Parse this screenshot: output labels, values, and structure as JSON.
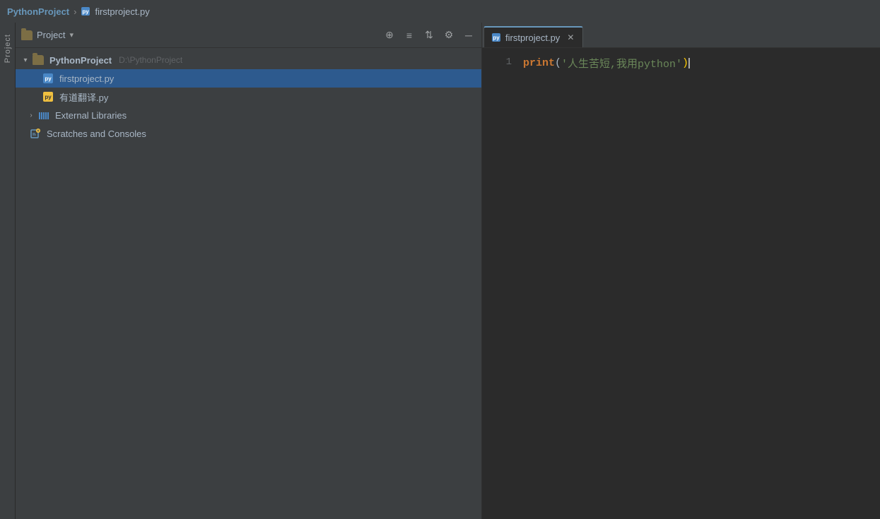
{
  "titlebar": {
    "project_name": "PythonProject",
    "separator": "›",
    "file_name": "firstproject.py"
  },
  "sidebar": {
    "panel_label": "Project",
    "dropdown_label": "▾"
  },
  "toolbar": {
    "icons": [
      "⊕",
      "≡",
      "⇅",
      "⚙",
      "─"
    ]
  },
  "tree": {
    "root": {
      "name": "PythonProject",
      "path": "D:\\PythonProject",
      "expanded": true
    },
    "files": [
      {
        "name": "firstproject.py",
        "type": "py",
        "selected": true
      },
      {
        "name": "有道翻译.py",
        "type": "py",
        "selected": false
      }
    ],
    "folders": [
      {
        "name": "External Libraries",
        "type": "library",
        "expanded": false
      },
      {
        "name": "Scratches and Consoles",
        "type": "scratch"
      }
    ]
  },
  "editor": {
    "tab_label": "firstproject.py",
    "line_number": "1",
    "code": {
      "keyword": "print",
      "open_paren": "(",
      "string": "'人生苦短,我用python'",
      "close_paren": ")"
    }
  },
  "side_panel": {
    "label": "Project"
  }
}
